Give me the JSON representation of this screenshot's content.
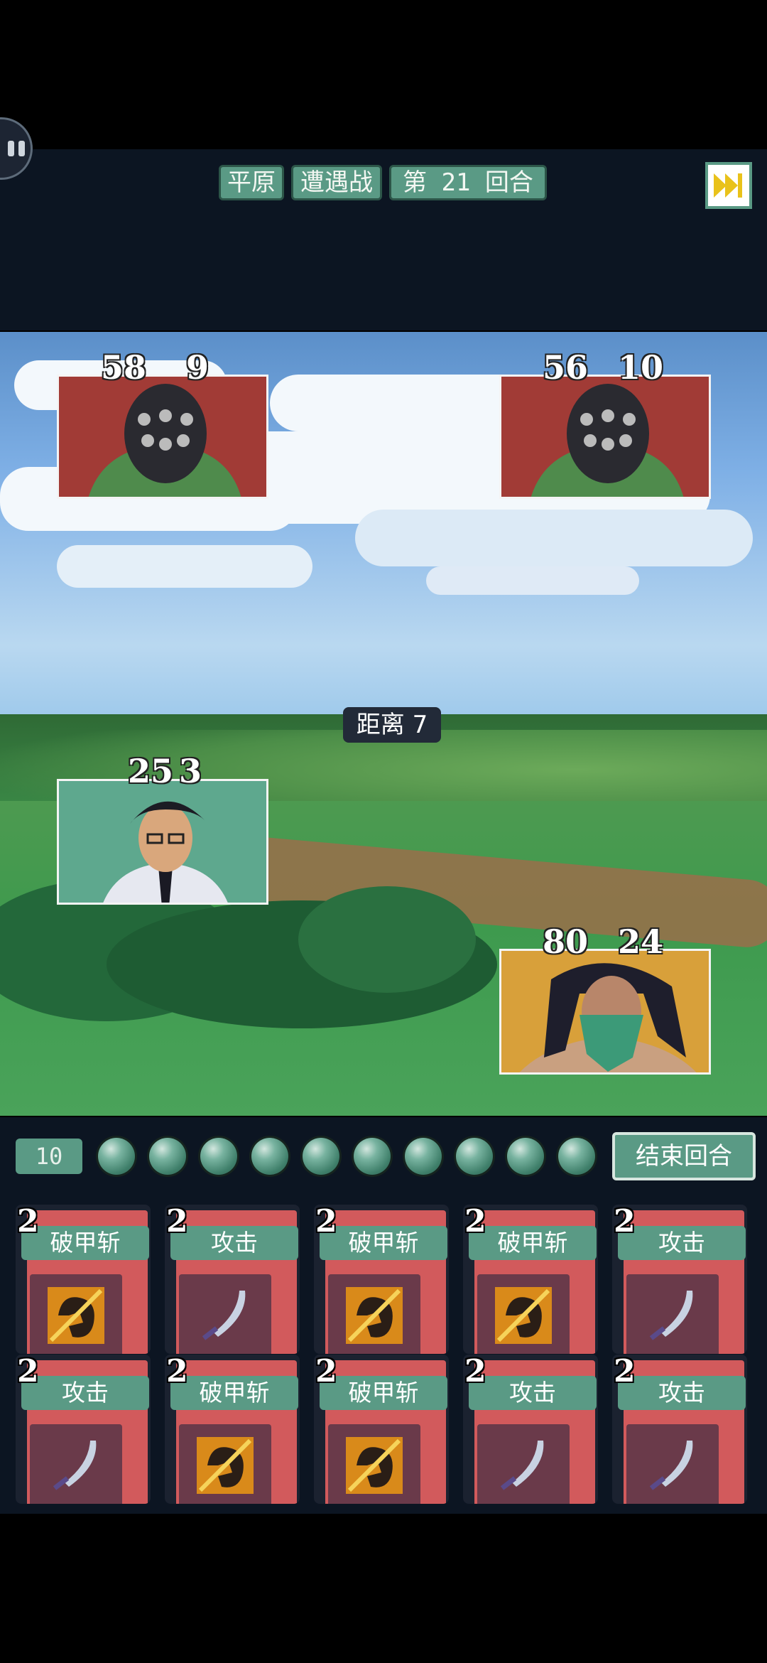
{
  "header": {
    "terrain": "平原",
    "battle_type": "遭遇战",
    "round_label": "第 21 回合"
  },
  "enemies": [
    {
      "name": "enemy-1",
      "hp": "58",
      "armor": "9"
    },
    {
      "name": "enemy-2",
      "hp": "56",
      "armor": "10"
    }
  ],
  "allies": [
    {
      "name": "ally-glasses",
      "hp": "25",
      "armor": "3"
    },
    {
      "name": "ally-masked",
      "hp": "80",
      "armor": "24"
    }
  ],
  "distance_label": "距离 7",
  "energy": {
    "count": "10",
    "orbs": 10
  },
  "end_turn_label": "结束回合",
  "cards": [
    {
      "cost": "2",
      "name": "破甲斩",
      "icon": "armor-break-icon"
    },
    {
      "cost": "2",
      "name": "攻击",
      "icon": "sword-icon"
    },
    {
      "cost": "2",
      "name": "破甲斩",
      "icon": "armor-break-icon"
    },
    {
      "cost": "2",
      "name": "破甲斩",
      "icon": "armor-break-icon"
    },
    {
      "cost": "2",
      "name": "攻击",
      "icon": "sword-icon"
    },
    {
      "cost": "2",
      "name": "攻击",
      "icon": "sword-icon"
    },
    {
      "cost": "2",
      "name": "破甲斩",
      "icon": "armor-break-icon"
    },
    {
      "cost": "2",
      "name": "破甲斩",
      "icon": "armor-break-icon"
    },
    {
      "cost": "2",
      "name": "攻击",
      "icon": "sword-icon"
    },
    {
      "cost": "2",
      "name": "攻击",
      "icon": "sword-icon"
    }
  ],
  "colors": {
    "accent": "#5a9a85",
    "panel": "#0c1522",
    "card": "#d25a5c"
  }
}
